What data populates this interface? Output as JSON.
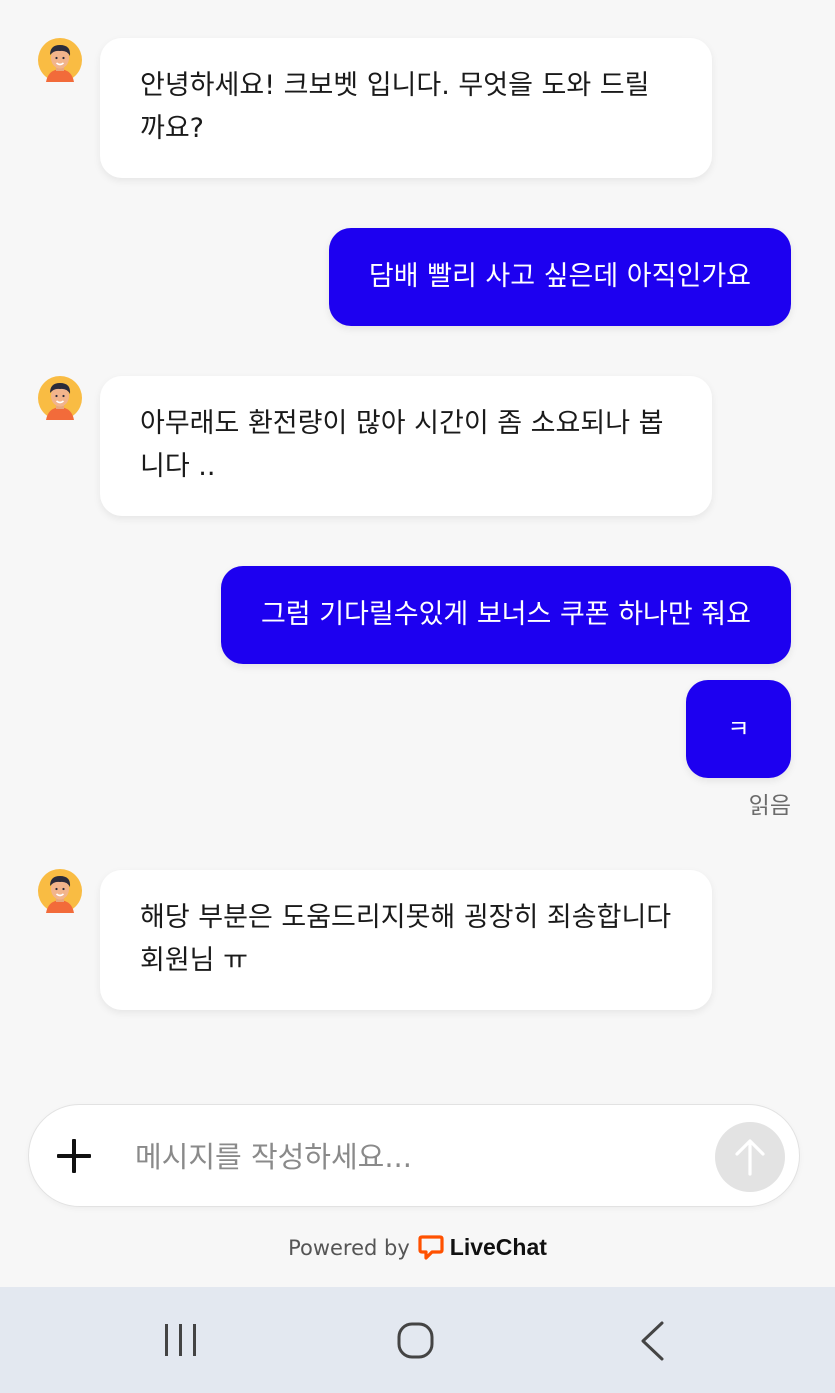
{
  "messages": [
    {
      "from": "agent",
      "text": "안녕하세요! 크보벳 입니다. 무엇을 도와 드릴까요?"
    },
    {
      "from": "user",
      "text": "담배 빨리 사고 싶은데 아직인가요"
    },
    {
      "from": "agent",
      "text": "아무래도 환전량이 많아 시간이 좀 소요되나 봅니다 .."
    },
    {
      "from": "user",
      "text": "그럼 기다릴수있게 보너스 쿠폰 하나만 줘요"
    },
    {
      "from": "user",
      "text": "ㅋ"
    },
    {
      "from": "agent",
      "text": "해당 부분은 도움드리지못해 굉장히 죄송합니다 회원님 ㅠ"
    }
  ],
  "read_status": "읽음",
  "composer": {
    "placeholder": "메시지를 작성하세요...",
    "value": ""
  },
  "footer": {
    "powered_by": "Powered by",
    "brand": "LiveChat",
    "brand_color": "#ff5100"
  },
  "colors": {
    "user_bubble": "#1d00f0",
    "agent_bubble": "#ffffff",
    "background": "#f7f7f7",
    "navbar": "#e3e8f0"
  },
  "icons": {
    "agent_avatar": "avatar-icon",
    "attach": "plus-icon",
    "send": "arrow-up-icon",
    "brand": "livechat-logo-icon",
    "nav_recent": "recent-apps-icon",
    "nav_home": "home-icon",
    "nav_back": "back-icon"
  }
}
